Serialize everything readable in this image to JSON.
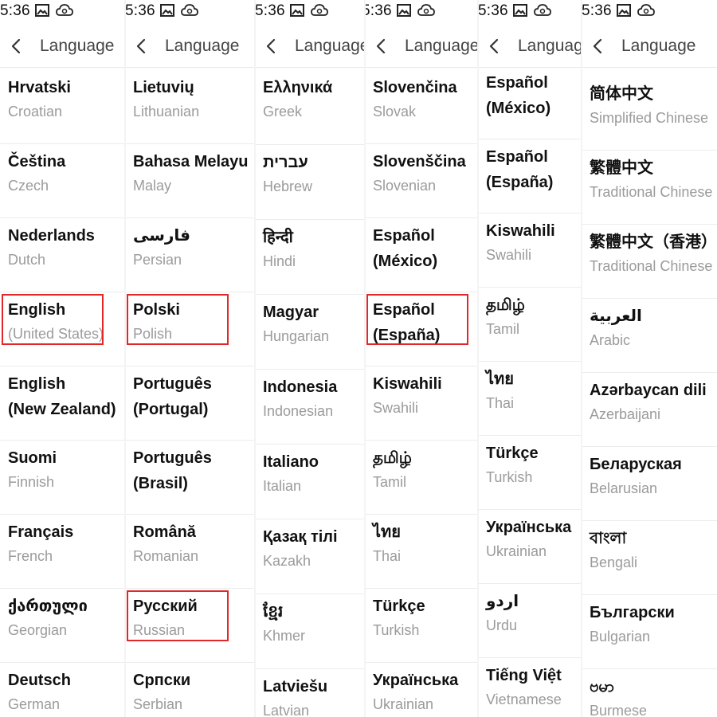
{
  "status": {
    "time": "5:36"
  },
  "header": {
    "title": "Language"
  },
  "panels": [
    {
      "items": [
        {
          "native": "Hrvatski",
          "english": "Croatian"
        },
        {
          "native": "Čeština",
          "english": "Czech"
        },
        {
          "native": "Nederlands",
          "english": "Dutch"
        },
        {
          "native": "English",
          "english": "(United States)",
          "highlighted": true
        },
        {
          "native": "English",
          "native2": "(New Zealand)",
          "english": ""
        },
        {
          "native": "Suomi",
          "english": "Finnish"
        },
        {
          "native": "Français",
          "english": "French"
        },
        {
          "native": "ქართული",
          "english": "Georgian"
        },
        {
          "native": "Deutsch",
          "english": "German"
        }
      ]
    },
    {
      "items": [
        {
          "native": "Lietuvių",
          "english": "Lithuanian"
        },
        {
          "native": "Bahasa Melayu",
          "english": "Malay"
        },
        {
          "native": "فارسی",
          "english": "Persian"
        },
        {
          "native": "Polski",
          "english": "Polish",
          "highlighted": true
        },
        {
          "native": "Português",
          "native2": "(Portugal)",
          "english": ""
        },
        {
          "native": "Português",
          "native2": "(Brasil)",
          "english": ""
        },
        {
          "native": "Română",
          "english": "Romanian"
        },
        {
          "native": "Русский",
          "english": "Russian",
          "highlighted": true
        },
        {
          "native": "Српски",
          "english": "Serbian"
        }
      ]
    },
    {
      "items": [
        {
          "native": "Ελληνικά",
          "english": "Greek"
        },
        {
          "native": "עברית",
          "english": "Hebrew"
        },
        {
          "native": "हिन्दी",
          "english": "Hindi"
        },
        {
          "native": "Magyar",
          "english": "Hungarian"
        },
        {
          "native": "Indonesia",
          "english": "Indonesian"
        },
        {
          "native": "Italiano",
          "english": "Italian"
        },
        {
          "native": "Қазақ тілі",
          "english": "Kazakh"
        },
        {
          "native": "ខ្មែរ",
          "english": "Khmer"
        },
        {
          "native": "Latviešu",
          "english": "Latvian"
        }
      ]
    },
    {
      "items": [
        {
          "native": "Slovenčina",
          "english": "Slovak"
        },
        {
          "native": "Slovenščina",
          "english": "Slovenian"
        },
        {
          "native": "Español",
          "native2": "(México)",
          "english": ""
        },
        {
          "native": "Español",
          "native2": "(España)",
          "english": "",
          "highlighted": true
        },
        {
          "native": "Kiswahili",
          "english": "Swahili"
        },
        {
          "native": "தமிழ்",
          "english": "Tamil"
        },
        {
          "native": "ไทย",
          "english": "Thai"
        },
        {
          "native": "Türkçe",
          "english": "Turkish"
        },
        {
          "native": "Українська",
          "english": "Ukrainian"
        }
      ]
    },
    {
      "items": [
        {
          "native": "Español",
          "native2": "(México)",
          "english": ""
        },
        {
          "native": "Español",
          "native2": "(España)",
          "english": ""
        },
        {
          "native": "Kiswahili",
          "english": "Swahili"
        },
        {
          "native": "தமிழ்",
          "english": "Tamil"
        },
        {
          "native": "ไทย",
          "english": "Thai"
        },
        {
          "native": "Türkçe",
          "english": "Turkish"
        },
        {
          "native": "Українська",
          "english": "Ukrainian"
        },
        {
          "native": "اردو",
          "english": "Urdu"
        },
        {
          "native": "Tiếng Việt",
          "english": "Vietnamese"
        }
      ]
    },
    {
      "items": [
        {
          "native": "简体中文",
          "english": "Simplified Chinese"
        },
        {
          "native": "繁體中文",
          "english": "Traditional Chinese"
        },
        {
          "native": "繁體中文（香港）",
          "english": "Traditional Chinese"
        },
        {
          "native": "العربية",
          "english": "Arabic"
        },
        {
          "native": "Azərbaycan dili",
          "english": "Azerbaijani"
        },
        {
          "native": "Беларуская",
          "english": "Belarusian"
        },
        {
          "native": "বাংলা",
          "english": "Bengali"
        },
        {
          "native": "Български",
          "english": "Bulgarian"
        },
        {
          "native": "ဗမာ",
          "english": "Burmese"
        }
      ]
    }
  ],
  "colors": {
    "highlight": "#e0282a",
    "native_text": "#111111",
    "english_text": "#9b9b9b"
  }
}
